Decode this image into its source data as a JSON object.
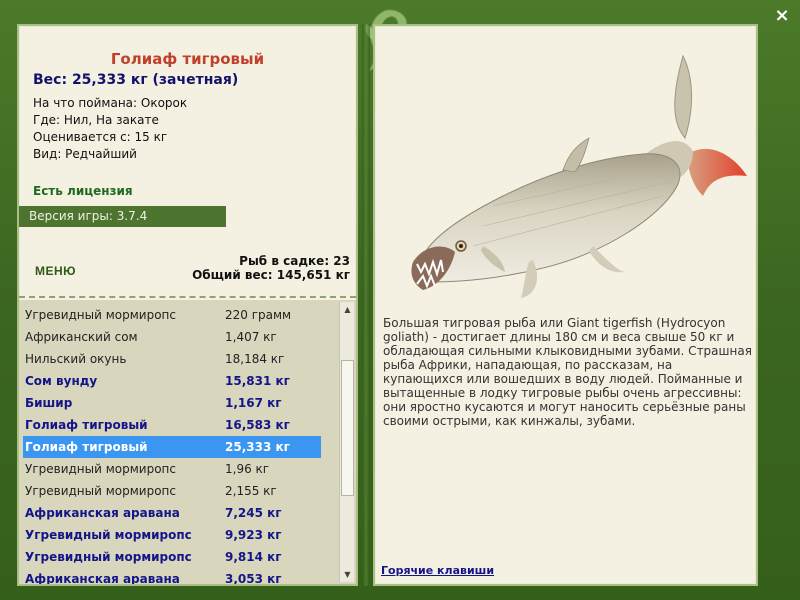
{
  "window": {
    "close_glyph": "×"
  },
  "fish_card": {
    "title": "Голиаф тигровый",
    "weight_line": "Вес: 25,333 кг (зачетная)",
    "caught_on": "На что поймана: Окорок",
    "where": "Где: Нил, На закате",
    "valued_from": "Оценивается с: 15 кг",
    "kind": "Вид: Редчайший"
  },
  "license": "Есть лицензия",
  "version": "Версия игры: 3.7.4",
  "menu_label": "МЕНЮ",
  "cage": {
    "fish_count": "Рыб в садке: 23",
    "total_weight": "Общий вес: 145,651 кг"
  },
  "fish_list": [
    {
      "name": "Угревидный мормиропс",
      "weight": "220 грамм",
      "bold": false
    },
    {
      "name": "Африканский сом",
      "weight": "1,407 кг",
      "bold": false
    },
    {
      "name": "Нильский окунь",
      "weight": "18,184 кг",
      "bold": false
    },
    {
      "name": "Сом вунду",
      "weight": "15,831 кг",
      "bold": true
    },
    {
      "name": "Бишир",
      "weight": "1,167 кг",
      "bold": true
    },
    {
      "name": "Голиаф тигровый",
      "weight": "16,583 кг",
      "bold": true
    },
    {
      "name": "Голиаф тигровый",
      "weight": "25,333 кг",
      "bold": true,
      "selected": true
    },
    {
      "name": "Угревидный мормиропс",
      "weight": "1,96 кг",
      "bold": false
    },
    {
      "name": "Угревидный мормиропс",
      "weight": "2,155 кг",
      "bold": false
    },
    {
      "name": "Африканская аравана",
      "weight": "7,245 кг",
      "bold": true
    },
    {
      "name": "Угревидный мормиропс",
      "weight": "9,923 кг",
      "bold": true
    },
    {
      "name": "Угревидный мормиропс",
      "weight": "9,814 кг",
      "bold": true
    },
    {
      "name": "Африканская аравана",
      "weight": "3,053 кг",
      "bold": true
    }
  ],
  "scrollbar": {
    "up_glyph": "▲",
    "down_glyph": "▼"
  },
  "description": "Большая тигровая рыба или Giant tigerfish (Hydrocyon goliath) - достигает длины 180 см и веса свыше 50 кг и обладающая сильными клыковидными зубами. Страшная рыба Африки, нападающая, по рассказам, на купающихся или вошедших в воду людей. Пойманные и вытащенные в лодку тигровые рыбы очень агрессивны: они яростно кусаются и могут наносить серьёзные раны своими острыми, как кинжалы, зубами.",
  "hotkeys_label": "Горячие клавиши",
  "colors": {
    "frame_green": "#3e6a1f",
    "panel_bg": "#f4f1e2",
    "title_red": "#c0402a",
    "weight_navy": "#12126b",
    "selection_blue": "#3a96f0"
  }
}
